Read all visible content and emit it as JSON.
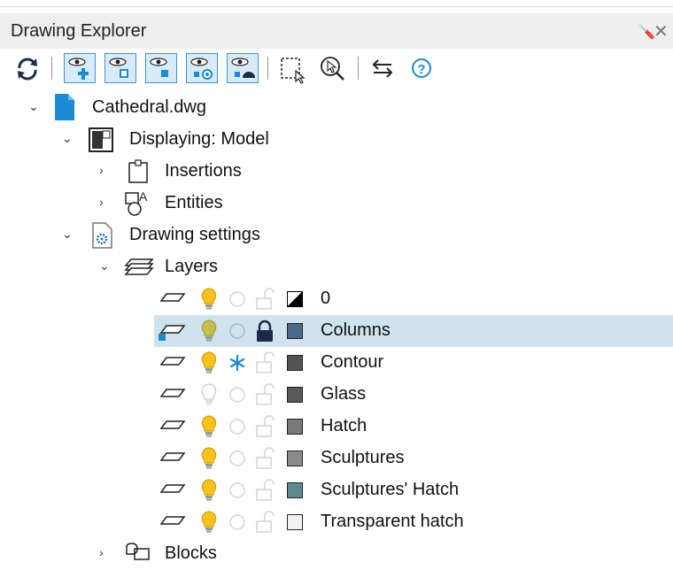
{
  "panel": {
    "title": "Drawing Explorer",
    "pin_icon": "pin-icon",
    "close_icon": "close-icon"
  },
  "toolbar": {
    "buttons": [
      {
        "name": "refresh-icon"
      },
      {
        "name": "new-view-icon"
      },
      {
        "name": "view-option-1-icon"
      },
      {
        "name": "view-option-2-icon"
      },
      {
        "name": "view-option-3-icon"
      },
      {
        "name": "view-option-4-icon"
      },
      {
        "name": "select-entities-icon"
      },
      {
        "name": "zoom-to-selection-icon"
      },
      {
        "name": "swap-icon"
      },
      {
        "name": "help-icon"
      }
    ]
  },
  "tree": {
    "file": "Cathedral.dwg",
    "displaying": "Displaying: Model",
    "insertions": "Insertions",
    "entities": "Entities",
    "drawing_settings": "Drawing settings",
    "layers": "Layers",
    "blocks": "Blocks"
  },
  "layers": [
    {
      "name": "0",
      "bulb": "on",
      "freeze": "thawed",
      "lock": "unlocked",
      "swatch": "#000000",
      "split": true,
      "current": false
    },
    {
      "name": "Columns",
      "bulb": "on",
      "freeze": "thawed",
      "lock": "locked",
      "swatch": "#4b6a8a",
      "split": false,
      "current": true
    },
    {
      "name": "Contour",
      "bulb": "on",
      "freeze": "frozen",
      "lock": "unlocked",
      "swatch": "#545454",
      "split": false,
      "current": false
    },
    {
      "name": "Glass",
      "bulb": "off",
      "freeze": "thawed",
      "lock": "unlocked",
      "swatch": "#595959",
      "split": false,
      "current": false
    },
    {
      "name": "Hatch",
      "bulb": "on",
      "freeze": "thawed",
      "lock": "unlocked",
      "swatch": "#7a7a7a",
      "split": false,
      "current": false
    },
    {
      "name": "Sculptures",
      "bulb": "on",
      "freeze": "thawed",
      "lock": "unlocked",
      "swatch": "#8a8a8a",
      "split": false,
      "current": false
    },
    {
      "name": "Sculptures' Hatch",
      "bulb": "on",
      "freeze": "thawed",
      "lock": "unlocked",
      "swatch": "#5c8a8e",
      "split": false,
      "current": false
    },
    {
      "name": "Transparent hatch",
      "bulb": "on",
      "freeze": "thawed",
      "lock": "unlocked",
      "swatch": "#f2f2f2",
      "split": false,
      "current": false
    }
  ],
  "colors": {
    "accent": "#1a8ad4",
    "selection": "#cfe3ee",
    "bulb_on": "#f7c21a",
    "bulb_dim": "#c5c04c"
  }
}
